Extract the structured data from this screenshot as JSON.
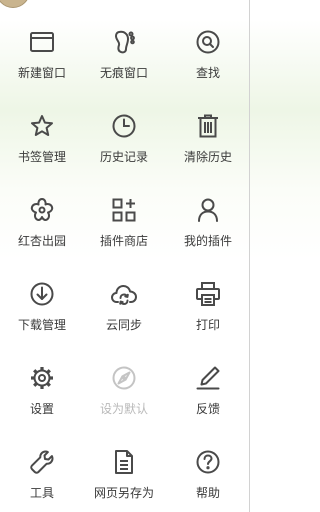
{
  "menu": {
    "items": [
      {
        "label": "新建窗口",
        "icon": "new-window-icon",
        "enabled": true
      },
      {
        "label": "无痕窗口",
        "icon": "footprint-icon",
        "enabled": true
      },
      {
        "label": "查找",
        "icon": "search-icon",
        "enabled": true
      },
      {
        "label": "书签管理",
        "icon": "star-icon",
        "enabled": true
      },
      {
        "label": "历史记录",
        "icon": "clock-icon",
        "enabled": true
      },
      {
        "label": "清除历史",
        "icon": "trash-icon",
        "enabled": true
      },
      {
        "label": "红杏出园",
        "icon": "flower-icon",
        "enabled": true
      },
      {
        "label": "插件商店",
        "icon": "apps-grid-icon",
        "enabled": true
      },
      {
        "label": "我的插件",
        "icon": "person-icon",
        "enabled": true
      },
      {
        "label": "下载管理",
        "icon": "download-icon",
        "enabled": true
      },
      {
        "label": "云同步",
        "icon": "cloud-sync-icon",
        "enabled": true
      },
      {
        "label": "打印",
        "icon": "printer-icon",
        "enabled": true
      },
      {
        "label": "设置",
        "icon": "gear-icon",
        "enabled": true
      },
      {
        "label": "设为默认",
        "icon": "compass-icon",
        "enabled": false
      },
      {
        "label": "反馈",
        "icon": "pen-icon",
        "enabled": true
      },
      {
        "label": "工具",
        "icon": "wrench-icon",
        "enabled": true
      },
      {
        "label": "网页另存为",
        "icon": "document-icon",
        "enabled": true
      },
      {
        "label": "帮助",
        "icon": "help-icon",
        "enabled": true
      }
    ]
  },
  "colors": {
    "icon": "#4a4a4a",
    "icon_disabled": "#c4c4c4",
    "label": "#3a3a3a",
    "label_disabled": "#b9b9b9",
    "accent_green": "#eef6e6"
  }
}
